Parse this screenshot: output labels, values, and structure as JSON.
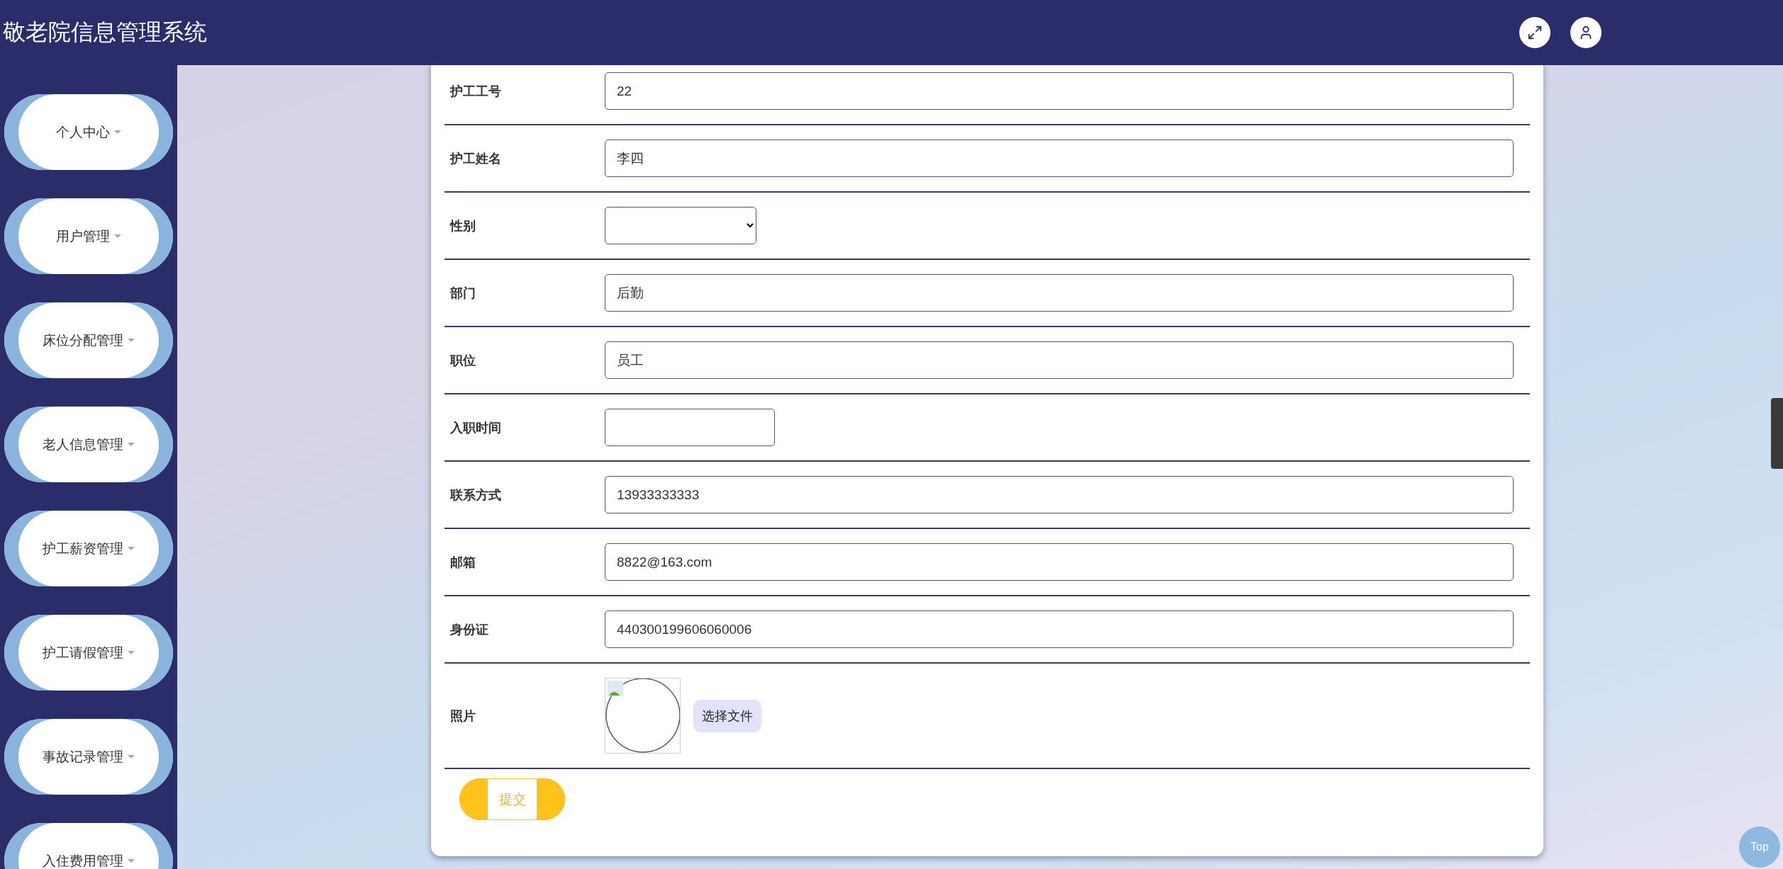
{
  "header": {
    "title": "敬老院信息管理系统"
  },
  "sidebar": {
    "items": [
      {
        "label": "个人中心"
      },
      {
        "label": "用户管理"
      },
      {
        "label": "床位分配管理"
      },
      {
        "label": "老人信息管理"
      },
      {
        "label": "护工薪资管理"
      },
      {
        "label": "护工请假管理"
      },
      {
        "label": "事故记录管理"
      },
      {
        "label": "入住费用管理"
      }
    ]
  },
  "form": {
    "fields": [
      {
        "label": "护工工号",
        "kind": "text",
        "value": "22"
      },
      {
        "label": "护工姓名",
        "kind": "text",
        "value": "李四"
      },
      {
        "label": "性别",
        "kind": "select"
      },
      {
        "label": "部门",
        "kind": "text",
        "value": "后勤"
      },
      {
        "label": "职位",
        "kind": "text",
        "value": "员工"
      },
      {
        "label": "入职时间",
        "kind": "date"
      },
      {
        "label": "联系方式",
        "kind": "text",
        "value": "13933333333"
      },
      {
        "label": "邮箱",
        "kind": "text",
        "value": "8822@163.com"
      },
      {
        "label": "身份证",
        "kind": "text",
        "value": "440300199606060006"
      },
      {
        "label": "照片",
        "kind": "photo",
        "button": "选择文件"
      }
    ],
    "submit": "提交"
  },
  "back_to_top": "Top"
}
